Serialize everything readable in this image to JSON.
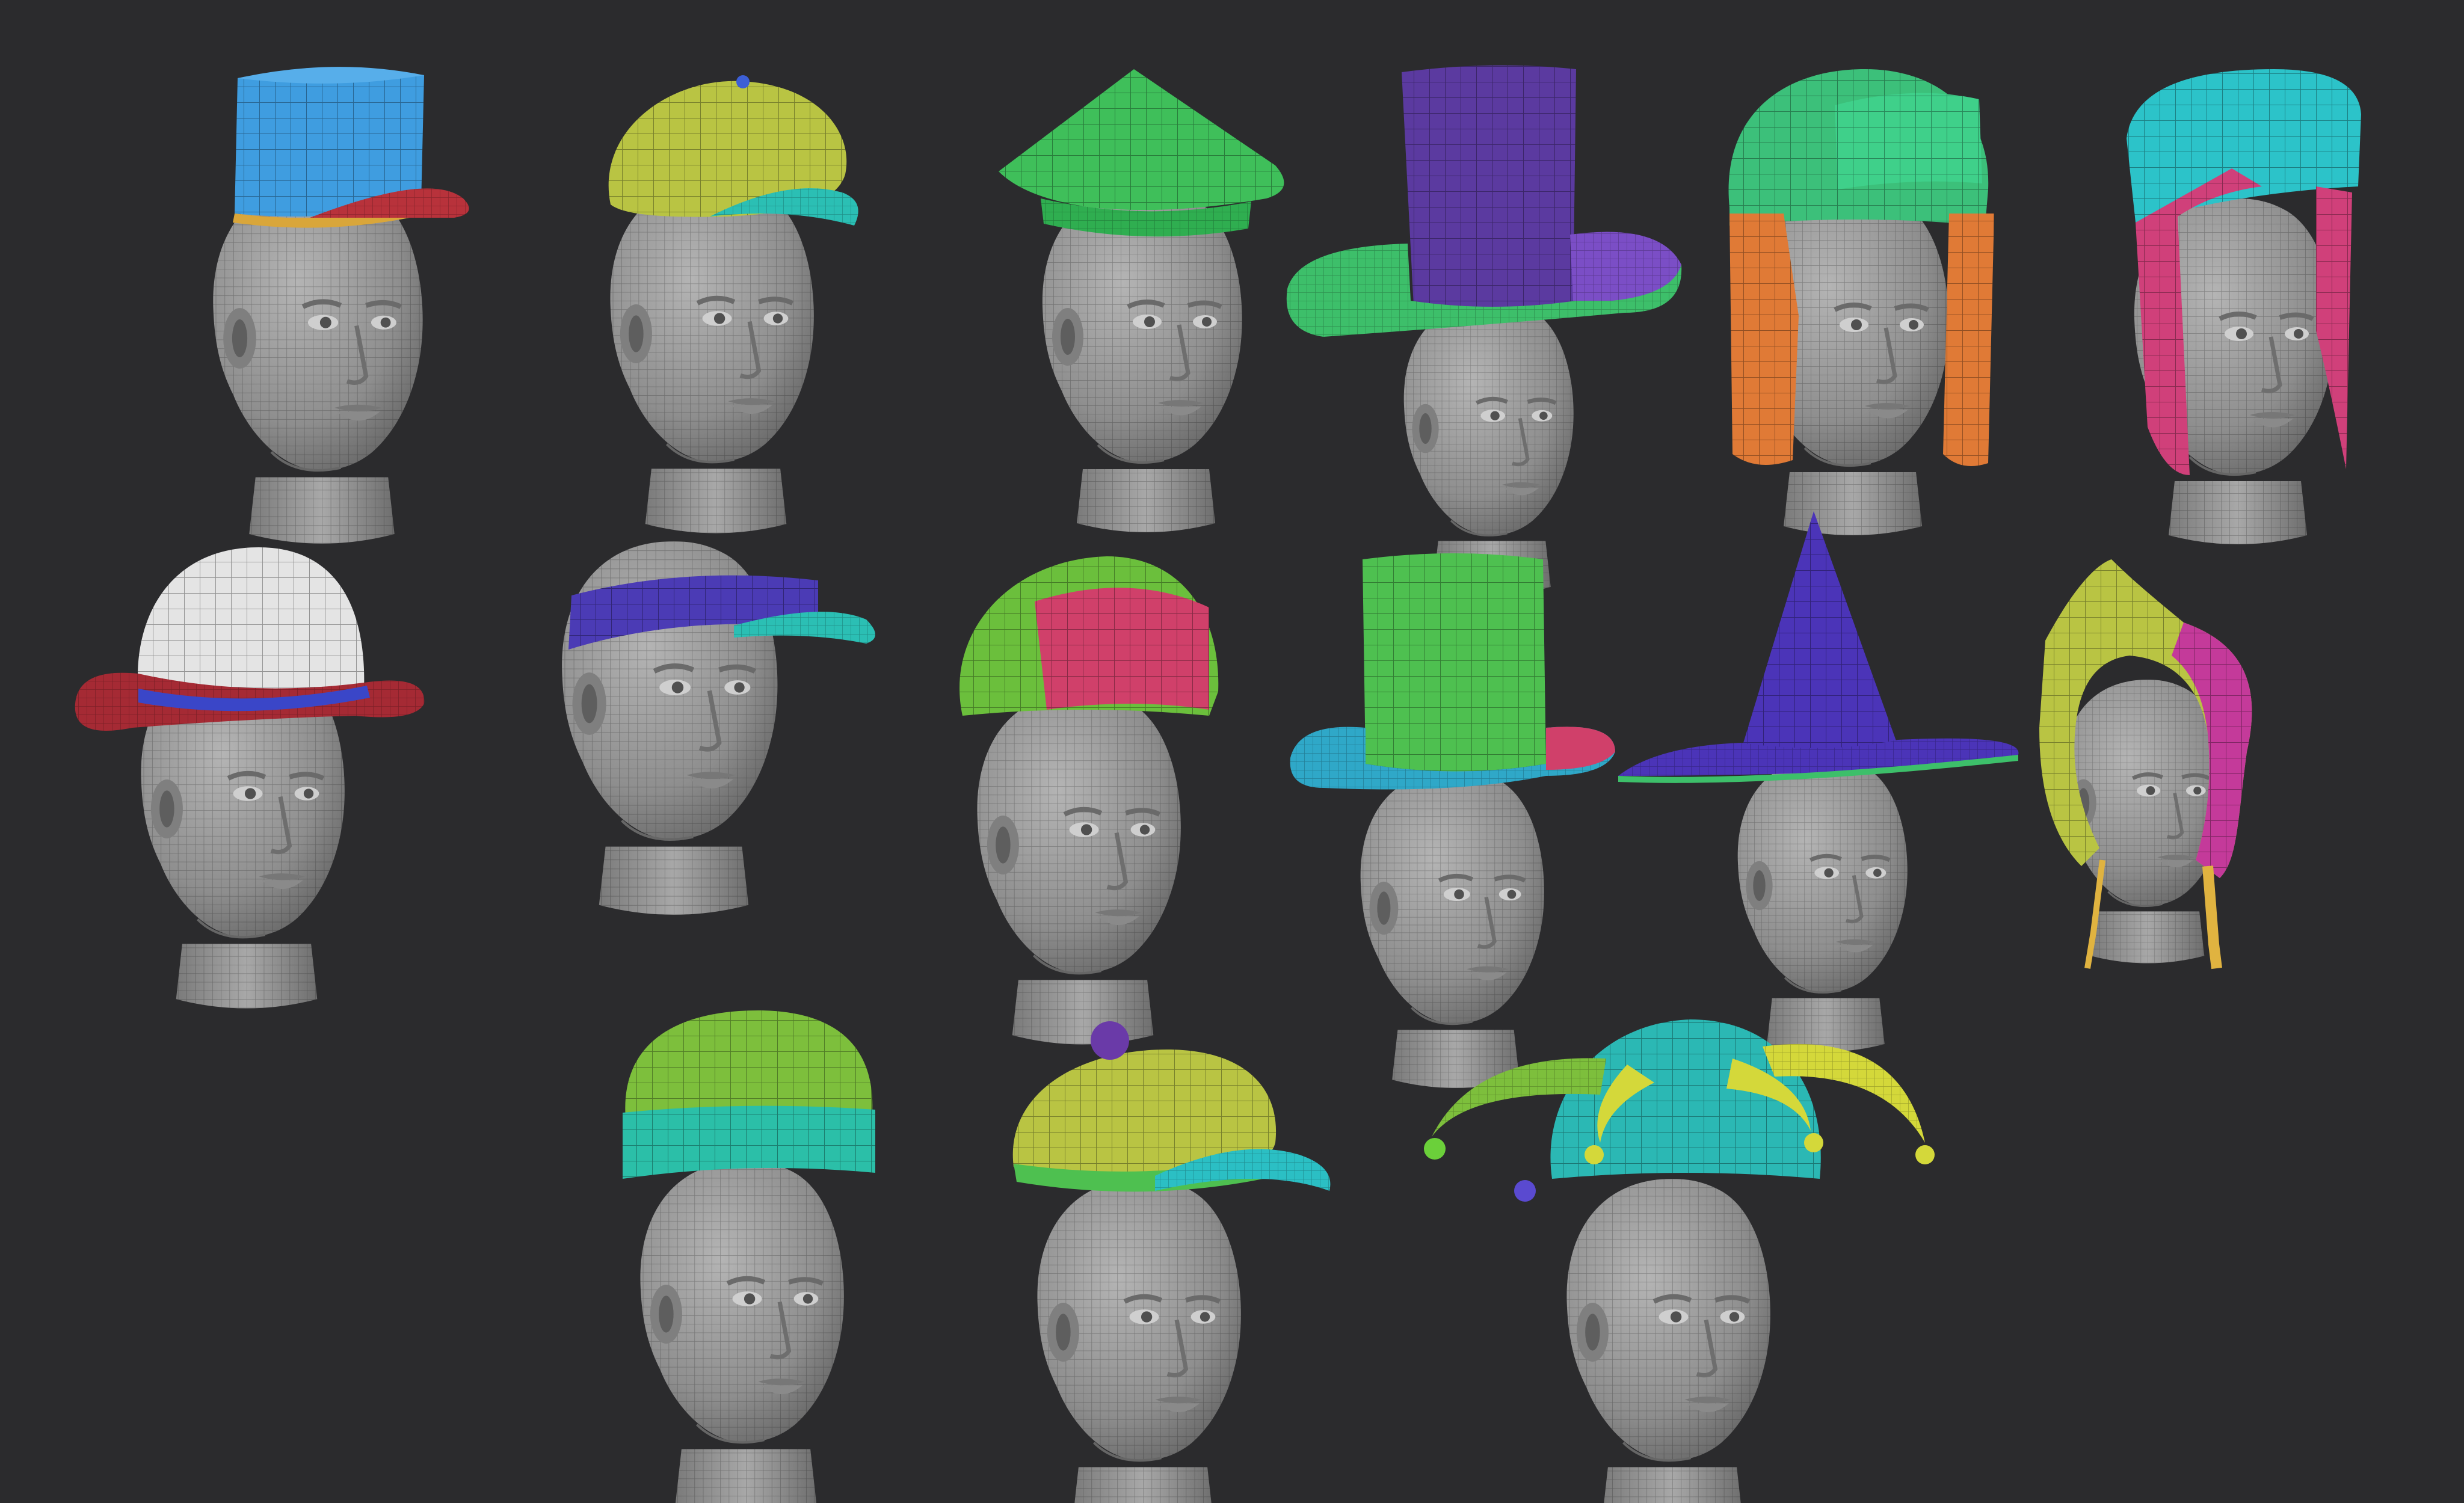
{
  "scene": {
    "background": "#2b2b2d",
    "head_color": "#9a9a9a",
    "head_shadow": "#6e6e6e",
    "wire_color": "#1a1a1a",
    "hats": [
      {
        "id": "pillbox-cap",
        "primary": "#3f9de0",
        "secondary": "#b8323b",
        "trim": "#d9a63a"
      },
      {
        "id": "newsboy-cap",
        "primary": "#b9c443",
        "secondary": "#2bbfb4",
        "trim": "#3c5fd6"
      },
      {
        "id": "coolie-hat",
        "primary": "#3fbf5a",
        "secondary": "#2fae50",
        "trim": "#2fae50"
      },
      {
        "id": "wide-top-hat",
        "primary": "#5b3aa0",
        "secondary": "#3dbf6a",
        "trim": "#7b4ec6"
      },
      {
        "id": "trapper-hat",
        "primary": "#3cc07a",
        "secondary": "#e07a36",
        "trim": "#3cc07a"
      },
      {
        "id": "hood-cap",
        "primary": "#2cc3c9",
        "secondary": "#d0407a",
        "trim": "#2cc3c9"
      },
      {
        "id": "bowler-hat",
        "primary": "#e4e4e4",
        "secondary": "#a52a34",
        "trim": "#3a46c8"
      },
      {
        "id": "visor",
        "primary": "#4b3bb5",
        "secondary": "#2bbfb4",
        "trim": "#4b3bb5"
      },
      {
        "id": "earflap-hat",
        "primary": "#6bbf3c",
        "secondary": "#d0406a",
        "trim": "#6bbf3c"
      },
      {
        "id": "top-hat",
        "primary": "#4ec050",
        "secondary": "#2fa8c8",
        "trim": "#d0406a"
      },
      {
        "id": "witch-hat",
        "primary": "#4b34b8",
        "secondary": "#4b34b8",
        "trim": "#3dbf6a"
      },
      {
        "id": "bonnet",
        "primary": "#b9c443",
        "secondary": "#c43a9a",
        "trim": "#e0b340"
      },
      {
        "id": "beanie",
        "primary": "#7dbf3c",
        "secondary": "#2bbfa8",
        "trim": "#2bbfa8"
      },
      {
        "id": "pompom-cap",
        "primary": "#b9c443",
        "secondary": "#2bbfc4",
        "trim": "#6a3aa8"
      },
      {
        "id": "jester-hat",
        "primary": "#2bb8b4",
        "secondary": "#7dbf3c",
        "trim": "#d4d83a"
      }
    ]
  }
}
